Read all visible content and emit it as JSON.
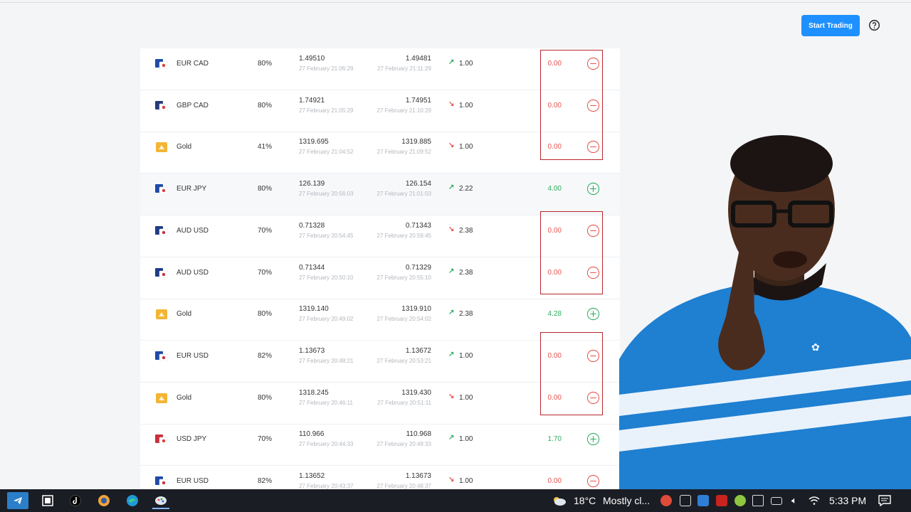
{
  "header": {
    "start_trading_label": "Start Trading"
  },
  "trades": [
    {
      "asset": "EUR CAD",
      "payout": "80%",
      "open_price": "1.49510",
      "open_time": "27 February 21:06:29",
      "close_price": "1.49481",
      "close_time": "27 February 21:11:29",
      "direction": "up",
      "amount": "1.00",
      "profit": "0.00",
      "result": "loss",
      "flag": "eur-cad"
    },
    {
      "asset": "GBP CAD",
      "payout": "80%",
      "open_price": "1.74921",
      "open_time": "27 February 21:05:29",
      "close_price": "1.74951",
      "close_time": "27 February 21:10:29",
      "direction": "down",
      "amount": "1.00",
      "profit": "0.00",
      "result": "loss",
      "flag": "gbp-cad"
    },
    {
      "asset": "Gold",
      "payout": "41%",
      "open_price": "1319.695",
      "open_time": "27 February 21:04:52",
      "close_price": "1319.885",
      "close_time": "27 February 21:09:52",
      "direction": "down",
      "amount": "1.00",
      "profit": "0.00",
      "result": "loss",
      "flag": "gold"
    },
    {
      "asset": "EUR JPY",
      "payout": "80%",
      "open_price": "126.139",
      "open_time": "27 February 20:56:03",
      "close_price": "126.154",
      "close_time": "27 February 21:01:03",
      "direction": "up",
      "amount": "2.22",
      "profit": "4.00",
      "result": "win",
      "flag": "eur-jpy"
    },
    {
      "asset": "AUD USD",
      "payout": "70%",
      "open_price": "0.71328",
      "open_time": "27 February 20:54:45",
      "close_price": "0.71343",
      "close_time": "27 February 20:59:45",
      "direction": "down",
      "amount": "2.38",
      "profit": "0.00",
      "result": "loss",
      "flag": "aud-usd"
    },
    {
      "asset": "AUD USD",
      "payout": "70%",
      "open_price": "0.71344",
      "open_time": "27 February 20:50:10",
      "close_price": "0.71329",
      "close_time": "27 February 20:55:10",
      "direction": "up",
      "amount": "2.38",
      "profit": "0.00",
      "result": "loss",
      "flag": "aud-usd"
    },
    {
      "asset": "Gold",
      "payout": "80%",
      "open_price": "1319.140",
      "open_time": "27 February 20:49:02",
      "close_price": "1319.910",
      "close_time": "27 February 20:54:02",
      "direction": "up",
      "amount": "2.38",
      "profit": "4.28",
      "result": "win",
      "flag": "gold"
    },
    {
      "asset": "EUR USD",
      "payout": "82%",
      "open_price": "1.13673",
      "open_time": "27 February 20:48:21",
      "close_price": "1.13672",
      "close_time": "27 February 20:53:21",
      "direction": "up",
      "amount": "1.00",
      "profit": "0.00",
      "result": "loss",
      "flag": "eur-usd"
    },
    {
      "asset": "Gold",
      "payout": "80%",
      "open_price": "1318.245",
      "open_time": "27 February 20:46:11",
      "close_price": "1319.430",
      "close_time": "27 February 20:51:11",
      "direction": "down",
      "amount": "1.00",
      "profit": "0.00",
      "result": "loss",
      "flag": "gold"
    },
    {
      "asset": "USD JPY",
      "payout": "70%",
      "open_price": "110.966",
      "open_time": "27 February 20:44:33",
      "close_price": "110.968",
      "close_time": "27 February 20:49:33",
      "direction": "up",
      "amount": "1.00",
      "profit": "1.70",
      "result": "win",
      "flag": "usd-jpy"
    },
    {
      "asset": "EUR USD",
      "payout": "82%",
      "open_price": "1.13652",
      "open_time": "27 February 20:43:37",
      "close_price": "1.13673",
      "close_time": "27 February 20:48:37",
      "direction": "down",
      "amount": "1.00",
      "profit": "0.00",
      "result": "loss",
      "flag": "eur-usd"
    }
  ],
  "colors": {
    "accent": "#1e90ff",
    "win": "#2fae62",
    "loss": "#e4554f",
    "highlight": "#b8262b"
  },
  "taskbar": {
    "apps": [
      "telegram-icon",
      "terminal-icon",
      "tiktok-icon",
      "browser-icon",
      "edge-icon",
      "paint-icon"
    ],
    "weather_temp": "18°C",
    "weather_desc": "Mostly cl...",
    "time": "5:33 PM"
  }
}
